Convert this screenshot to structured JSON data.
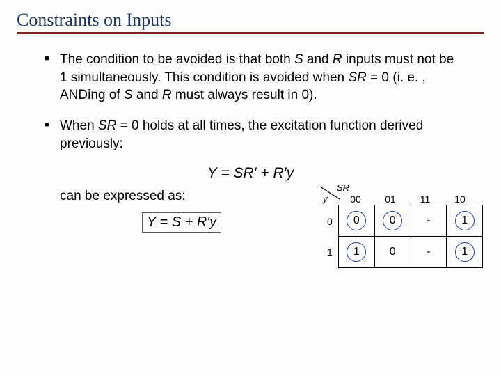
{
  "title": "Constraints on Inputs",
  "bullets": {
    "b1_html": "The condition to be avoided is that both <span class='i'>S</span> and <span class='i'>R</span> inputs must not be 1 simultaneously. This condition is avoided when <span class='i'>SR</span> = 0 (i.&nbsp;e.&nbsp;, ANDing of <span class='i'>S</span> and <span class='i'>R</span> must always result in 0).",
    "b2_html": "When <span class='i'>SR</span> = 0 holds at all times, the excitation function derived previously:"
  },
  "equations": {
    "eq1_html": "Y = SR&prime; + R&prime;y",
    "can_be": "can be expressed as:",
    "eq2_html": "Y = S + R&prime;y"
  },
  "kmap": {
    "row_var": "y",
    "col_var": "SR",
    "col_labels": [
      "00",
      "01",
      "11",
      "10"
    ],
    "row_labels": [
      "0",
      "1"
    ],
    "cells": [
      [
        {
          "v": "0",
          "circled": true
        },
        {
          "v": "0",
          "circled": true
        },
        {
          "v": "-",
          "circled": false
        },
        {
          "v": "1",
          "circled": true
        }
      ],
      [
        {
          "v": "1",
          "circled": true
        },
        {
          "v": "0",
          "circled": false
        },
        {
          "v": "-",
          "circled": false
        },
        {
          "v": "1",
          "circled": true
        }
      ]
    ]
  },
  "chart_data": {
    "type": "table",
    "description": "Karnaugh map for Y with inputs SR (columns) and y (rows)",
    "columns": [
      "00",
      "01",
      "11",
      "10"
    ],
    "rows": [
      "0",
      "1"
    ],
    "values": [
      [
        "0",
        "0",
        "-",
        "1"
      ],
      [
        "1",
        "0",
        "-",
        "1"
      ]
    ],
    "circled_cells": [
      [
        0,
        0
      ],
      [
        0,
        1
      ],
      [
        0,
        3
      ],
      [
        1,
        0
      ],
      [
        1,
        3
      ]
    ]
  }
}
